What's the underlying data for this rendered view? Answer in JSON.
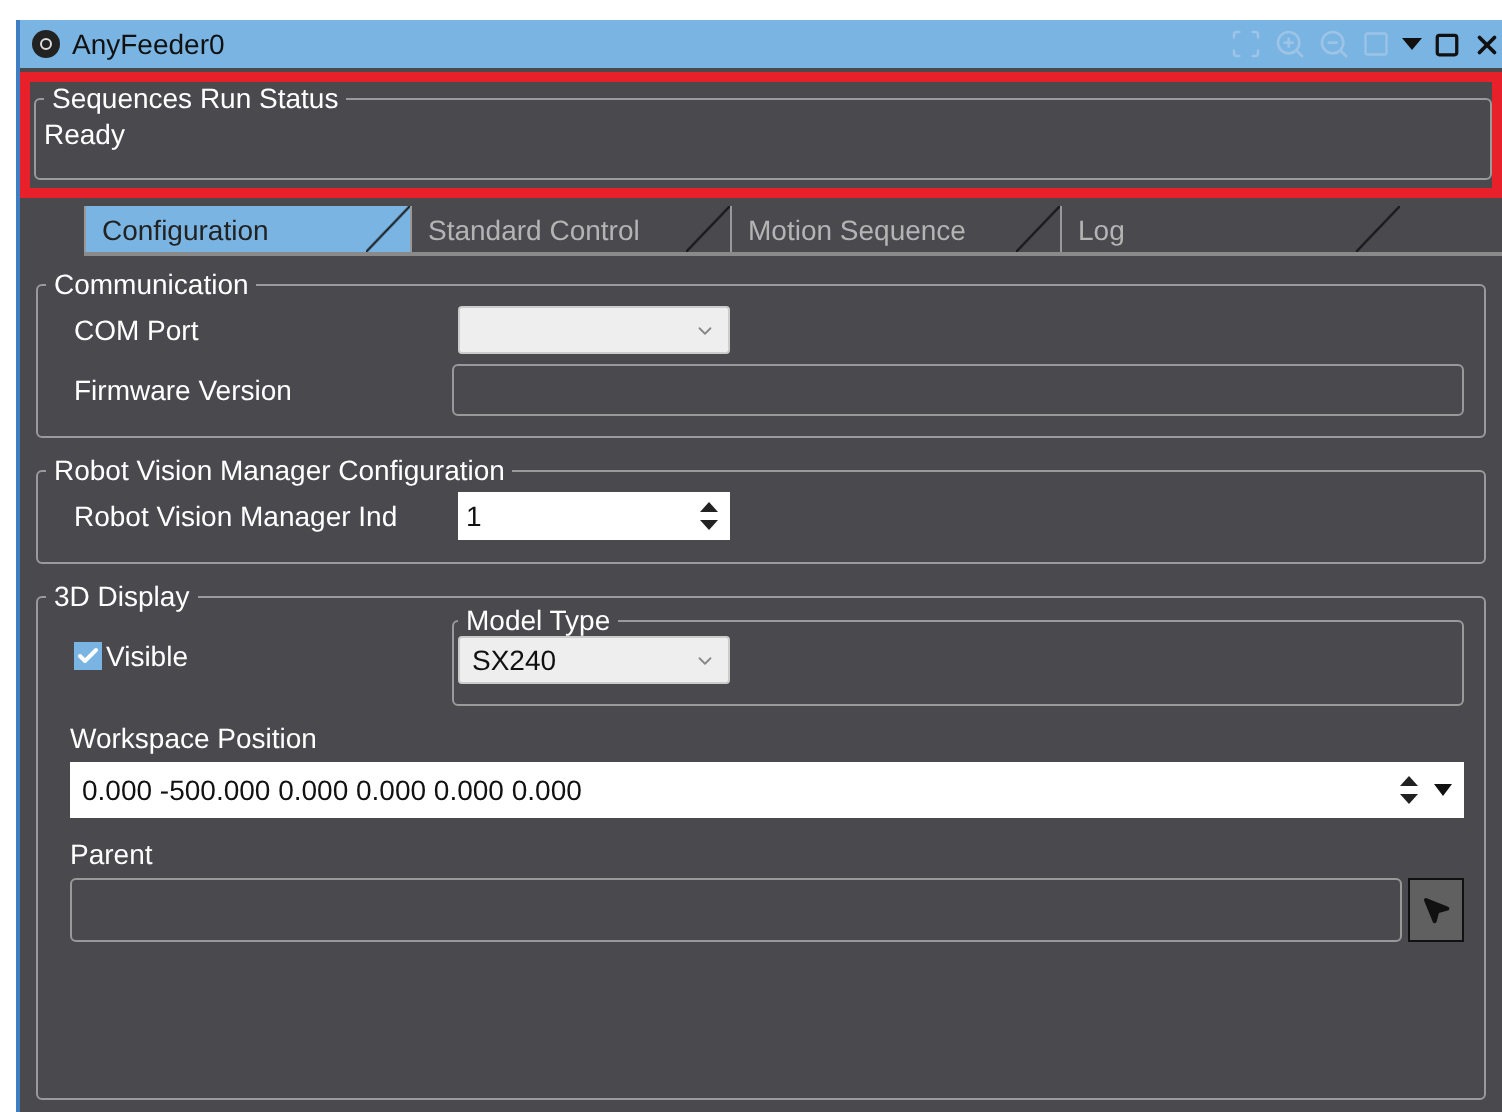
{
  "window": {
    "title": "AnyFeeder0"
  },
  "status": {
    "legend": "Sequences Run Status",
    "value": "Ready",
    "highlighted": true
  },
  "tabs": [
    {
      "label": "Configuration",
      "selected": true
    },
    {
      "label": "Standard Control",
      "selected": false
    },
    {
      "label": "Motion Sequence",
      "selected": false
    },
    {
      "label": "Log",
      "selected": false
    }
  ],
  "communication": {
    "legend": "Communication",
    "com_port": {
      "label": "COM Port"
    },
    "firmware": {
      "label": "Firmware Version"
    }
  },
  "rvm": {
    "legend": "Robot Vision Manager Configuration",
    "index": {
      "label": "Robot Vision Manager Ind",
      "value": "1"
    }
  },
  "display": {
    "legend": "3D Display",
    "visible": {
      "label": "Visible",
      "checked": true
    },
    "model_type": {
      "legend": "Model Type",
      "value": "SX240"
    },
    "workspace": {
      "label": "Workspace Position",
      "value": "0.000 -500.000 0.000 0.000 0.000 0.000"
    },
    "parent": {
      "label": "Parent"
    }
  }
}
